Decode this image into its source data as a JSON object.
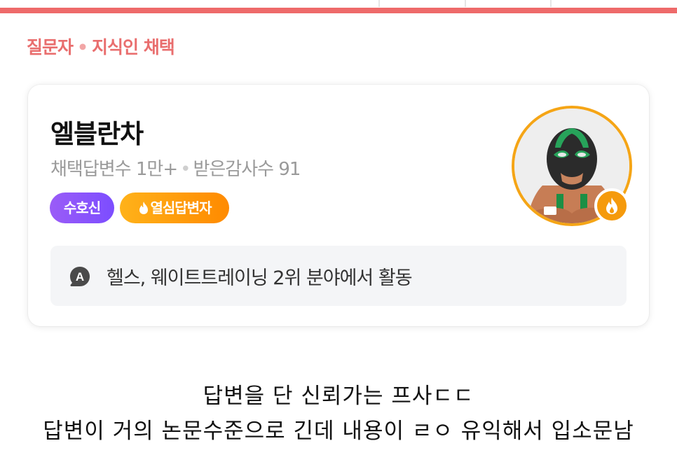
{
  "section": {
    "label_asker": "질문자",
    "label_expert": "지식인 채택"
  },
  "profile": {
    "name": "엘블란차",
    "stat_adopted": "채택답변수 1만+",
    "stat_thanks": "받은감사수 91",
    "badges": [
      "수호신",
      "열심답변자"
    ],
    "field_text": "헬스, 웨이트트레이닝 2위 분야에서 활동",
    "field_icon": "A"
  },
  "caption": {
    "line1": "답변을 단 신뢰가는 프사ㄷㄷ",
    "line2": "답변이 거의 논문수준으로 긴데 내용이 ㄹㅇ 유익해서 입소문남"
  },
  "colors": {
    "accent": "#ee6a6a",
    "badge_purple": "#8a55fa",
    "badge_orange": "#ff9d0a"
  }
}
